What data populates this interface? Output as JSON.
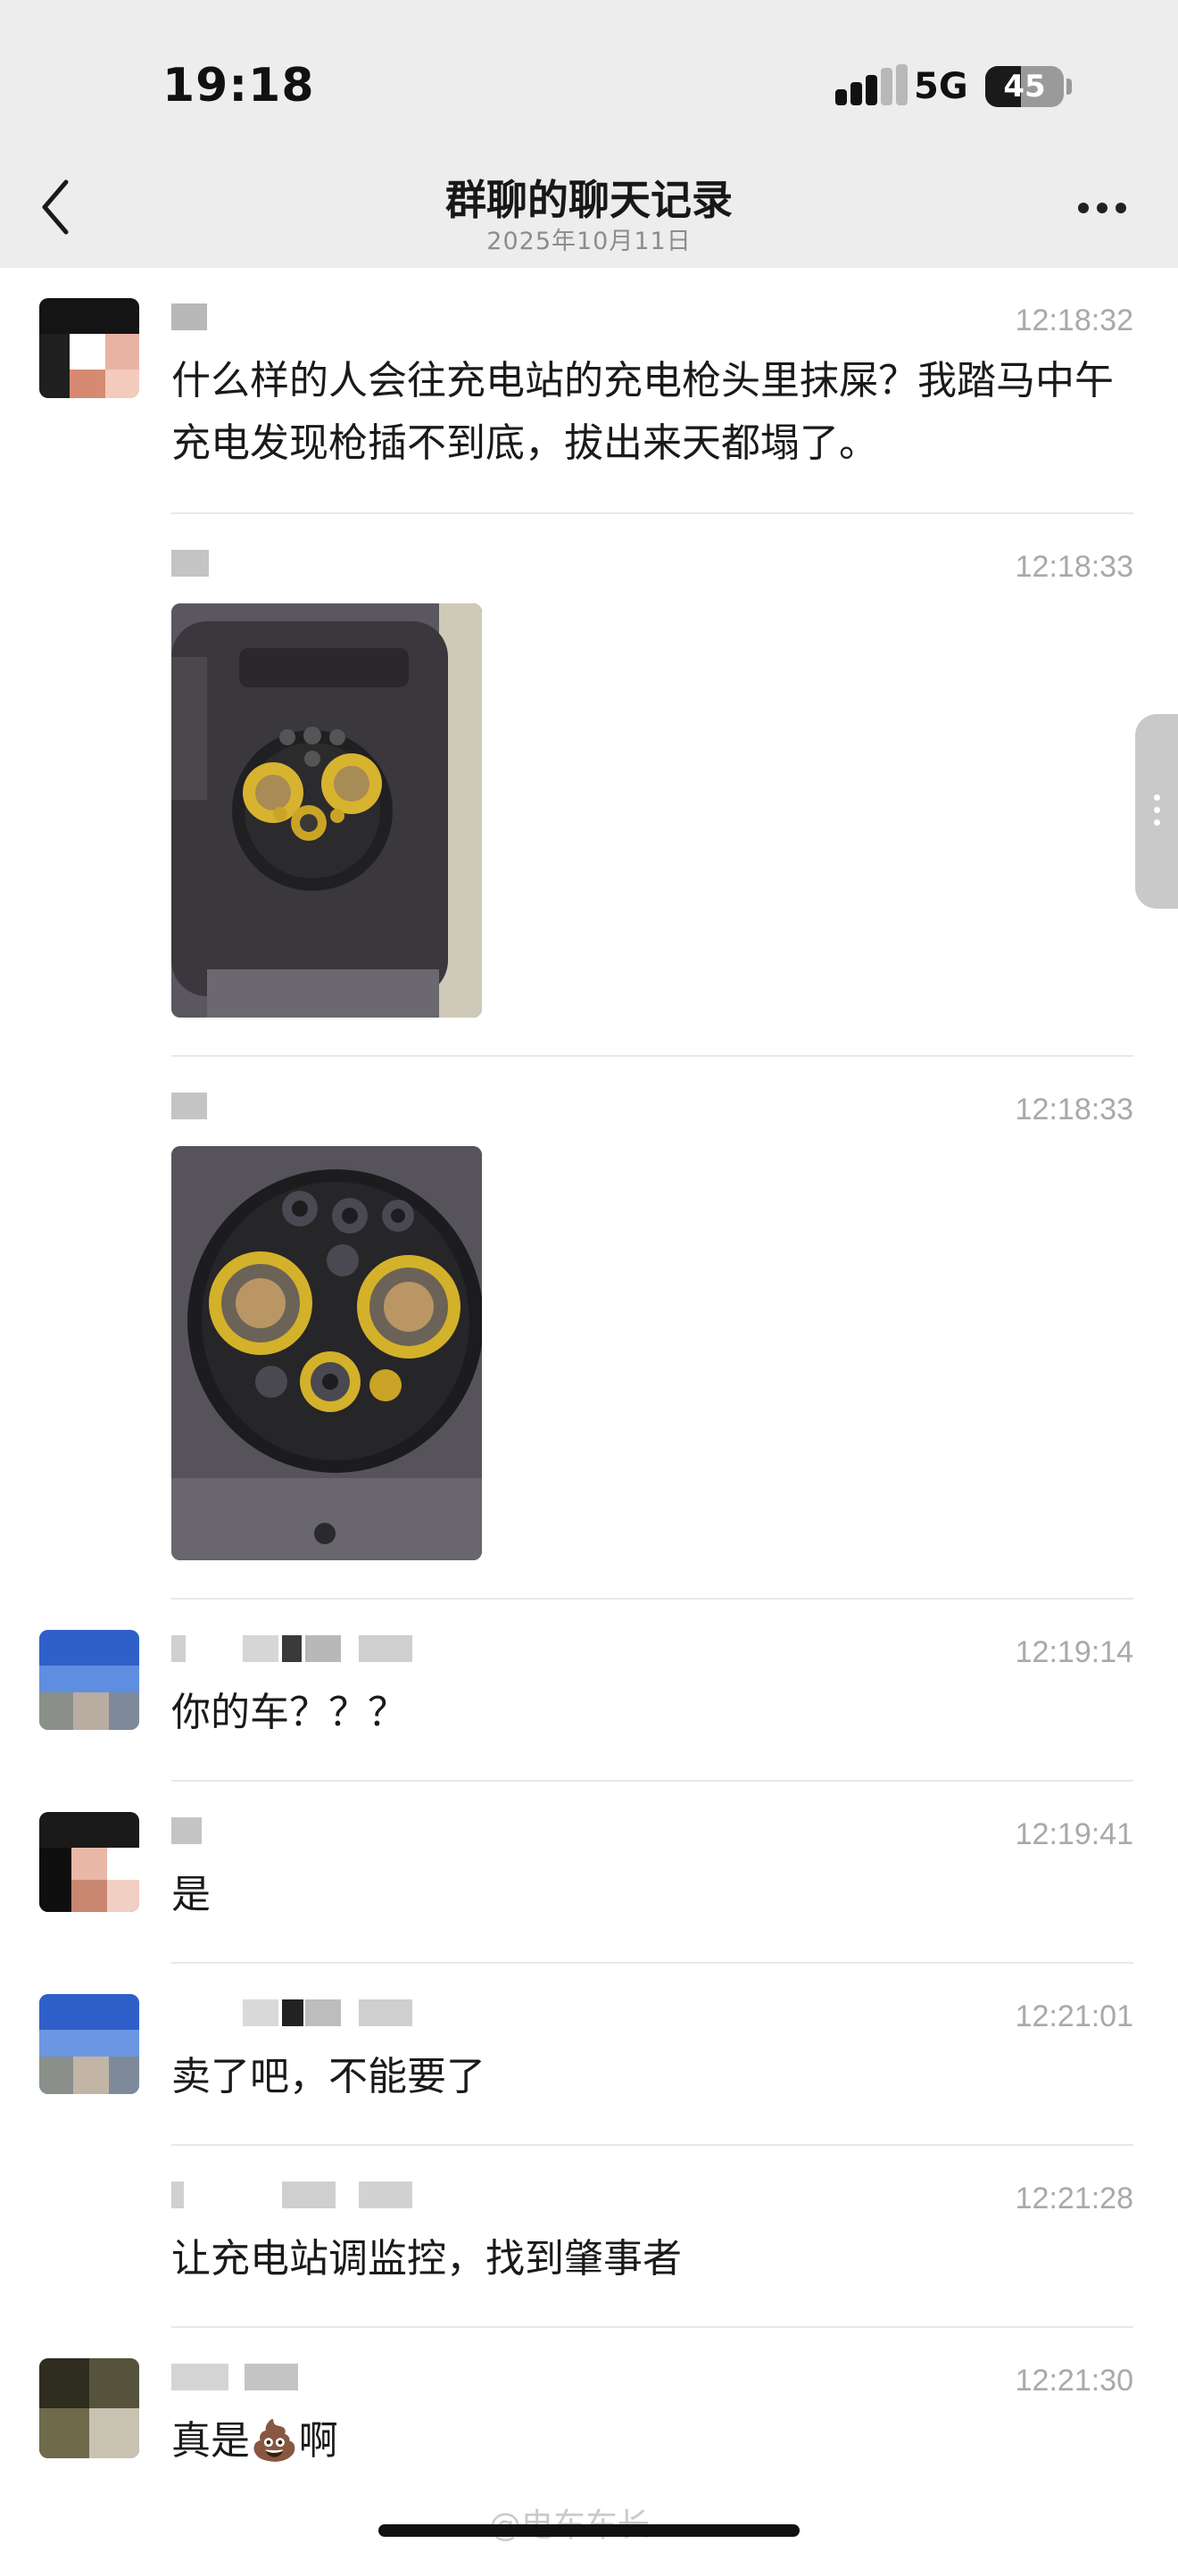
{
  "status_bar": {
    "time": "19:18",
    "network": "5G",
    "battery_level": "45",
    "battery_fraction": 0.45
  },
  "header": {
    "title": "群聊的聊天记录",
    "subtitle": "2025年10月11日"
  },
  "messages": [
    {
      "time": "12:18:32",
      "text": "什么样的人会往充电站的充电枪头里抹屎？我踏马中午充电发现枪插不到底，拔出来天都塌了。"
    },
    {
      "time": "12:18:33"
    },
    {
      "time": "12:18:33"
    },
    {
      "time": "12:19:14",
      "text": "你的车？？？"
    },
    {
      "time": "12:19:41",
      "text": "是"
    },
    {
      "time": "12:21:01",
      "text": "卖了吧，不能要了"
    },
    {
      "time": "12:21:28",
      "text": "让充电站调监控，找到肇事者"
    },
    {
      "time": "12:21:30",
      "text_before": "真是",
      "emoji": "💩",
      "text_after": "啊"
    }
  ],
  "watermark": "@电车车长",
  "colors": {
    "chrome_bg": "#ededed",
    "timestamp": "#a9a9a9",
    "divider": "#e8e8e8"
  }
}
